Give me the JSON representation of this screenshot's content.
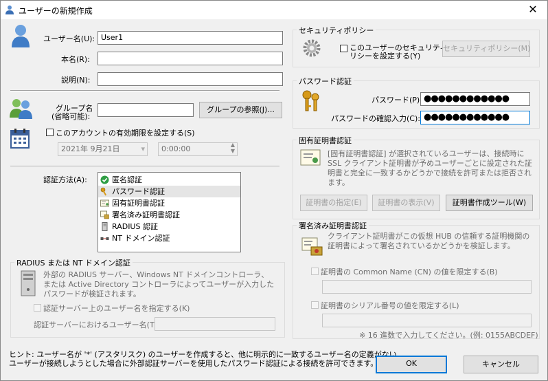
{
  "window": {
    "title": "ユーザーの新規作成",
    "close_glyph": "✕"
  },
  "user": {
    "username_label": "ユーザー名(U):",
    "username_value": "User1",
    "realname_label": "本名(R):",
    "realname_value": "",
    "description_label": "説明(N):",
    "description_value": ""
  },
  "group": {
    "label_line1": "グループ名",
    "label_line2": "(省略可能):",
    "value": "",
    "browse_button": "グループの参照(J)..."
  },
  "expiration": {
    "checkbox_label": "このアカウントの有効期限を設定する(S)",
    "date": "2021年  9月21日",
    "time": "0:00:00"
  },
  "auth": {
    "label": "認証方法(A):",
    "items": [
      {
        "label": "匿名認証",
        "icon": "check-circle-icon"
      },
      {
        "label": "パスワード認証",
        "icon": "key-icon"
      },
      {
        "label": "固有証明書認証",
        "icon": "certificate-icon"
      },
      {
        "label": "署名済み証明書認証",
        "icon": "signed-certificate-icon"
      },
      {
        "label": "RADIUS 認証",
        "icon": "server-icon"
      },
      {
        "label": "NT ドメイン認証",
        "icon": "network-icon"
      }
    ],
    "selected_index": 1
  },
  "radius": {
    "title": "RADIUS または NT ドメイン認証",
    "description": "外部の RADIUS サーバー、Windows NT ドメインコントローラ、または Active Directory コントローラによってユーザーが入力したパスワードが検証されます。",
    "checkbox_label": "認証サーバー上のユーザー名を指定する(K)",
    "server_username_label": "認証サーバーにおけるユーザー名(T):",
    "server_username_value": ""
  },
  "hint": {
    "line1": "ヒント: ユーザー名が '*' (アスタリスク) のユーザーを作成すると、他に明示的に一致するユーザー名の定義がない",
    "line2": "ユーザーが接続しようとした場合に外部認証サーバーを使用したパスワード認証による接続を許可できます。"
  },
  "security_policy": {
    "title": "セキュリティポリシー",
    "checkbox_line1": "このユーザーのセキュリティポ",
    "checkbox_line2": "リシーを設定する(Y)",
    "button": "セキュリティポリシー(M)"
  },
  "password": {
    "title": "パスワード認証",
    "password_label": "パスワード(P):",
    "password_value": "●●●●●●●●●●●●",
    "confirm_label": "パスワードの確認入力(C):",
    "confirm_value": "●●●●●●●●●●●●"
  },
  "cert": {
    "title": "固有証明書認証",
    "description": "[固有証明書認証] が選択されているユーザーは、接続時に SSL クライアント証明書が予めユーザーごとに設定された証明書と完全に一致するかどうかで接続を許可または拒否されます。",
    "specify_button": "証明書の指定(E)",
    "view_button": "証明書の表示(V)",
    "tool_button": "証明書作成ツール(W)"
  },
  "signed": {
    "title": "署名済み証明書認証",
    "description": "クライアント証明書がこの仮想 HUB の信頼する証明機関の証明書によって署名されているかどうかを検証します。",
    "cn_checkbox_label": "証明書の Common Name (CN) の値を限定する(B)",
    "cn_value": "",
    "serial_checkbox_label": "証明書のシリアル番号の値を限定する(L)",
    "serial_value": "",
    "serial_hint": "※ 16 進数で入力してください。(例: 0155ABCDEF)"
  },
  "footer": {
    "ok_button": "OK",
    "cancel_button": "キャンセル"
  }
}
